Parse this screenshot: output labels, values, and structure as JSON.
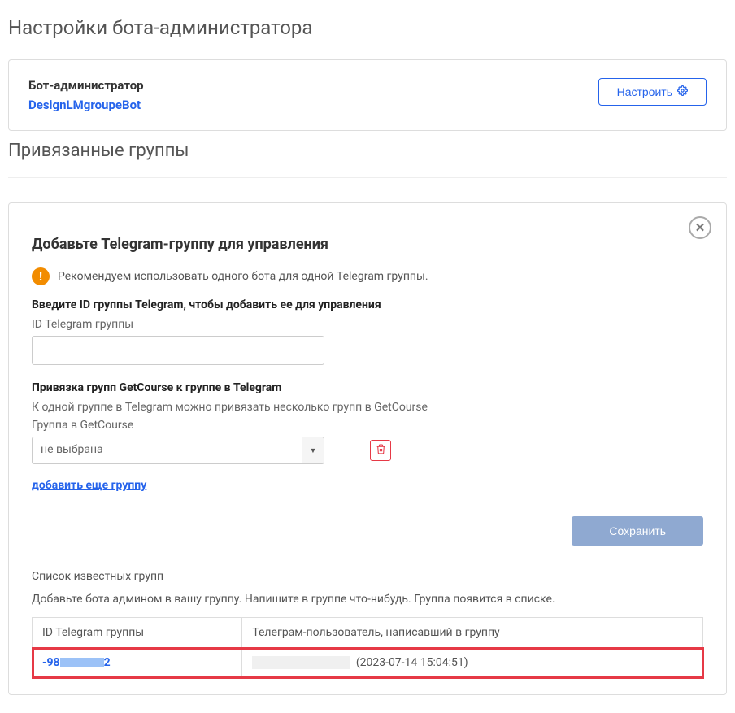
{
  "page_title": "Настройки бота-администратора",
  "bot_admin": {
    "label": "Бот-администратор",
    "name": "DesignLMgroupeBot",
    "configure_label": "Настроить"
  },
  "linked_groups_title": "Привязанные группы",
  "add_group": {
    "title": "Добавьте Telegram-группу для управления",
    "info_text": "Рекомендуем использовать одного бота для одной Telegram группы.",
    "enter_id_label": "Введите ID группы Telegram, чтобы добавить ее для управления",
    "id_field_label": "ID Telegram группы",
    "binding_label": "Привязка групп GetCourse к группе в Telegram",
    "binding_hint": "К одной группе в Telegram можно привязать несколько групп в GetCourse",
    "gc_group_label": "Группа в GetCourse",
    "select_placeholder": "не выбрана",
    "add_more_label": "добавить еще группу",
    "save_label": "Сохранить"
  },
  "known_groups": {
    "title": "Список известных групп",
    "help": "Добавьте бота админом в вашу группу. Напишите в группе что-нибудь. Группа появится в списке.",
    "columns": [
      "ID Telegram группы",
      "Телеграм-пользователь, написавший в группу"
    ],
    "rows": [
      {
        "id_prefix": "-98",
        "id_suffix": "2",
        "timestamp": "(2023-07-14 15:04:51)"
      }
    ]
  }
}
